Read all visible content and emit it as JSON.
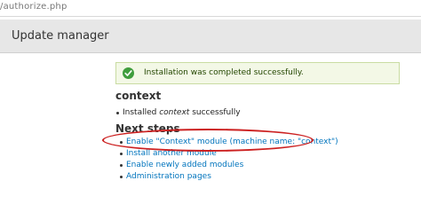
{
  "browser": {
    "url": "/authorize.php"
  },
  "header": {
    "title": "Update manager"
  },
  "status": {
    "message": "Installation was completed successfully.",
    "icon": "check-icon",
    "color": "#3f9d3d"
  },
  "module": {
    "name": "context",
    "result_prefix": "Installed",
    "result_name": "context",
    "result_suffix": "successfully"
  },
  "next_steps": {
    "title": "Next steps",
    "items": [
      {
        "label": "Enable \"Context\" module (machine name: \"context\")"
      },
      {
        "label": "Install another module"
      },
      {
        "label": "Enable newly added modules"
      },
      {
        "label": "Administration pages"
      }
    ]
  },
  "annotation": {
    "color": "#cc2020"
  }
}
